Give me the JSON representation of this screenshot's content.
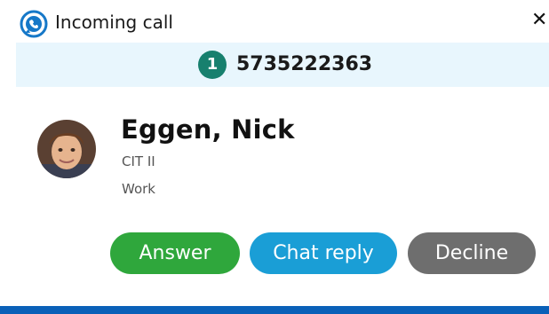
{
  "header": {
    "app_icon": "softphone-app-icon",
    "title": "Incoming call",
    "close_symbol": "✕"
  },
  "banner": {
    "line_badge": "1",
    "phone_number": "5735222363",
    "background_color": "#e8f6fd",
    "badge_color": "#17806e"
  },
  "caller": {
    "avatar_icon": "contact-avatar",
    "name": "Eggen, Nick",
    "title": "CIT II",
    "label": "Work"
  },
  "actions": {
    "answer_label": "Answer",
    "chat_reply_label": "Chat reply",
    "decline_label": "Decline",
    "answer_color": "#2fa73c",
    "chat_reply_color": "#1a9ed6",
    "decline_color": "#6e6e6e"
  },
  "footer": {
    "accent_color": "#0a60b8"
  }
}
